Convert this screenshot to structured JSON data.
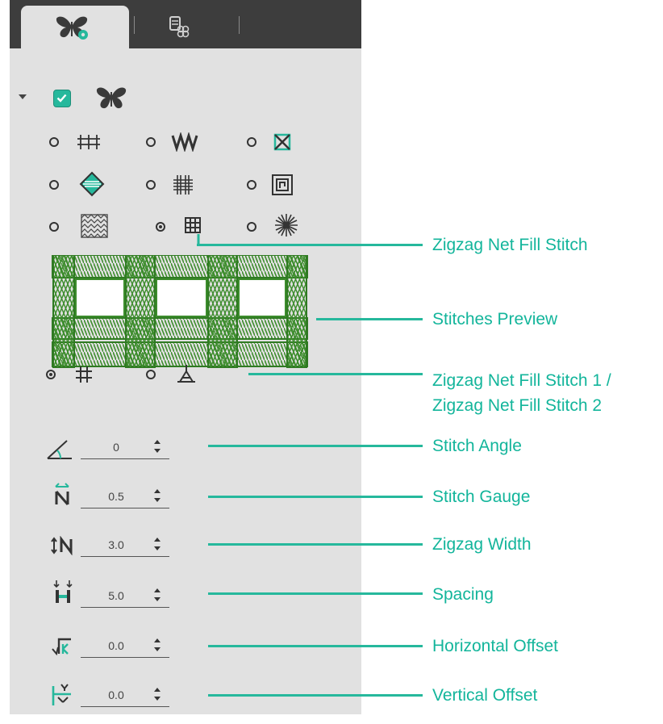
{
  "tabs": [
    {
      "icon": "butterfly-gear-icon",
      "active": true
    },
    {
      "icon": "thread-spools-icon",
      "active": false
    }
  ],
  "colors": {
    "accent": "#26b89c",
    "panel": "#e1e1e1",
    "tabbar": "#3d3d3d",
    "stitch_green": "#3c8c2c"
  },
  "fill_types": [
    {
      "icon": "running-stitch-fill-icon",
      "selected": false
    },
    {
      "icon": "zigzag-fill-icon",
      "selected": false
    },
    {
      "icon": "cross-box-fill-icon",
      "selected": false
    },
    {
      "icon": "diamond-fill-icon",
      "selected": false
    },
    {
      "icon": "net-grid-fill-icon",
      "selected": false
    },
    {
      "icon": "concentric-square-fill-icon",
      "selected": false
    },
    {
      "icon": "pattern-texture-fill-icon",
      "selected": false
    },
    {
      "icon": "zigzag-net-fill-icon",
      "selected": true
    },
    {
      "icon": "radial-fill-icon",
      "selected": false
    }
  ],
  "net_variants": [
    {
      "icon": "hash-net-icon",
      "selected": true
    },
    {
      "icon": "triangle-net-icon",
      "selected": false
    }
  ],
  "fields": [
    {
      "icon": "stitch-angle-icon",
      "value": "0"
    },
    {
      "icon": "stitch-gauge-icon",
      "value": "0.5"
    },
    {
      "icon": "zigzag-width-icon",
      "value": "3.0"
    },
    {
      "icon": "spacing-icon",
      "value": "5.0"
    },
    {
      "icon": "horizontal-offset-icon",
      "value": "0.0"
    },
    {
      "icon": "vertical-offset-icon",
      "value": "0.0"
    }
  ],
  "callouts": {
    "net_fill": "Zigzag Net Fill Stitch",
    "preview": "Stitches Preview",
    "variant_line1": "Zigzag Net Fill Stitch 1 /",
    "variant_line2": "Zigzag Net Fill Stitch 2",
    "angle": "Stitch Angle",
    "gauge": "Stitch Gauge",
    "width": "Zigzag Width",
    "spacing": "Spacing",
    "h_offset": "Horizontal Offset",
    "v_offset": "Vertical Offset"
  }
}
